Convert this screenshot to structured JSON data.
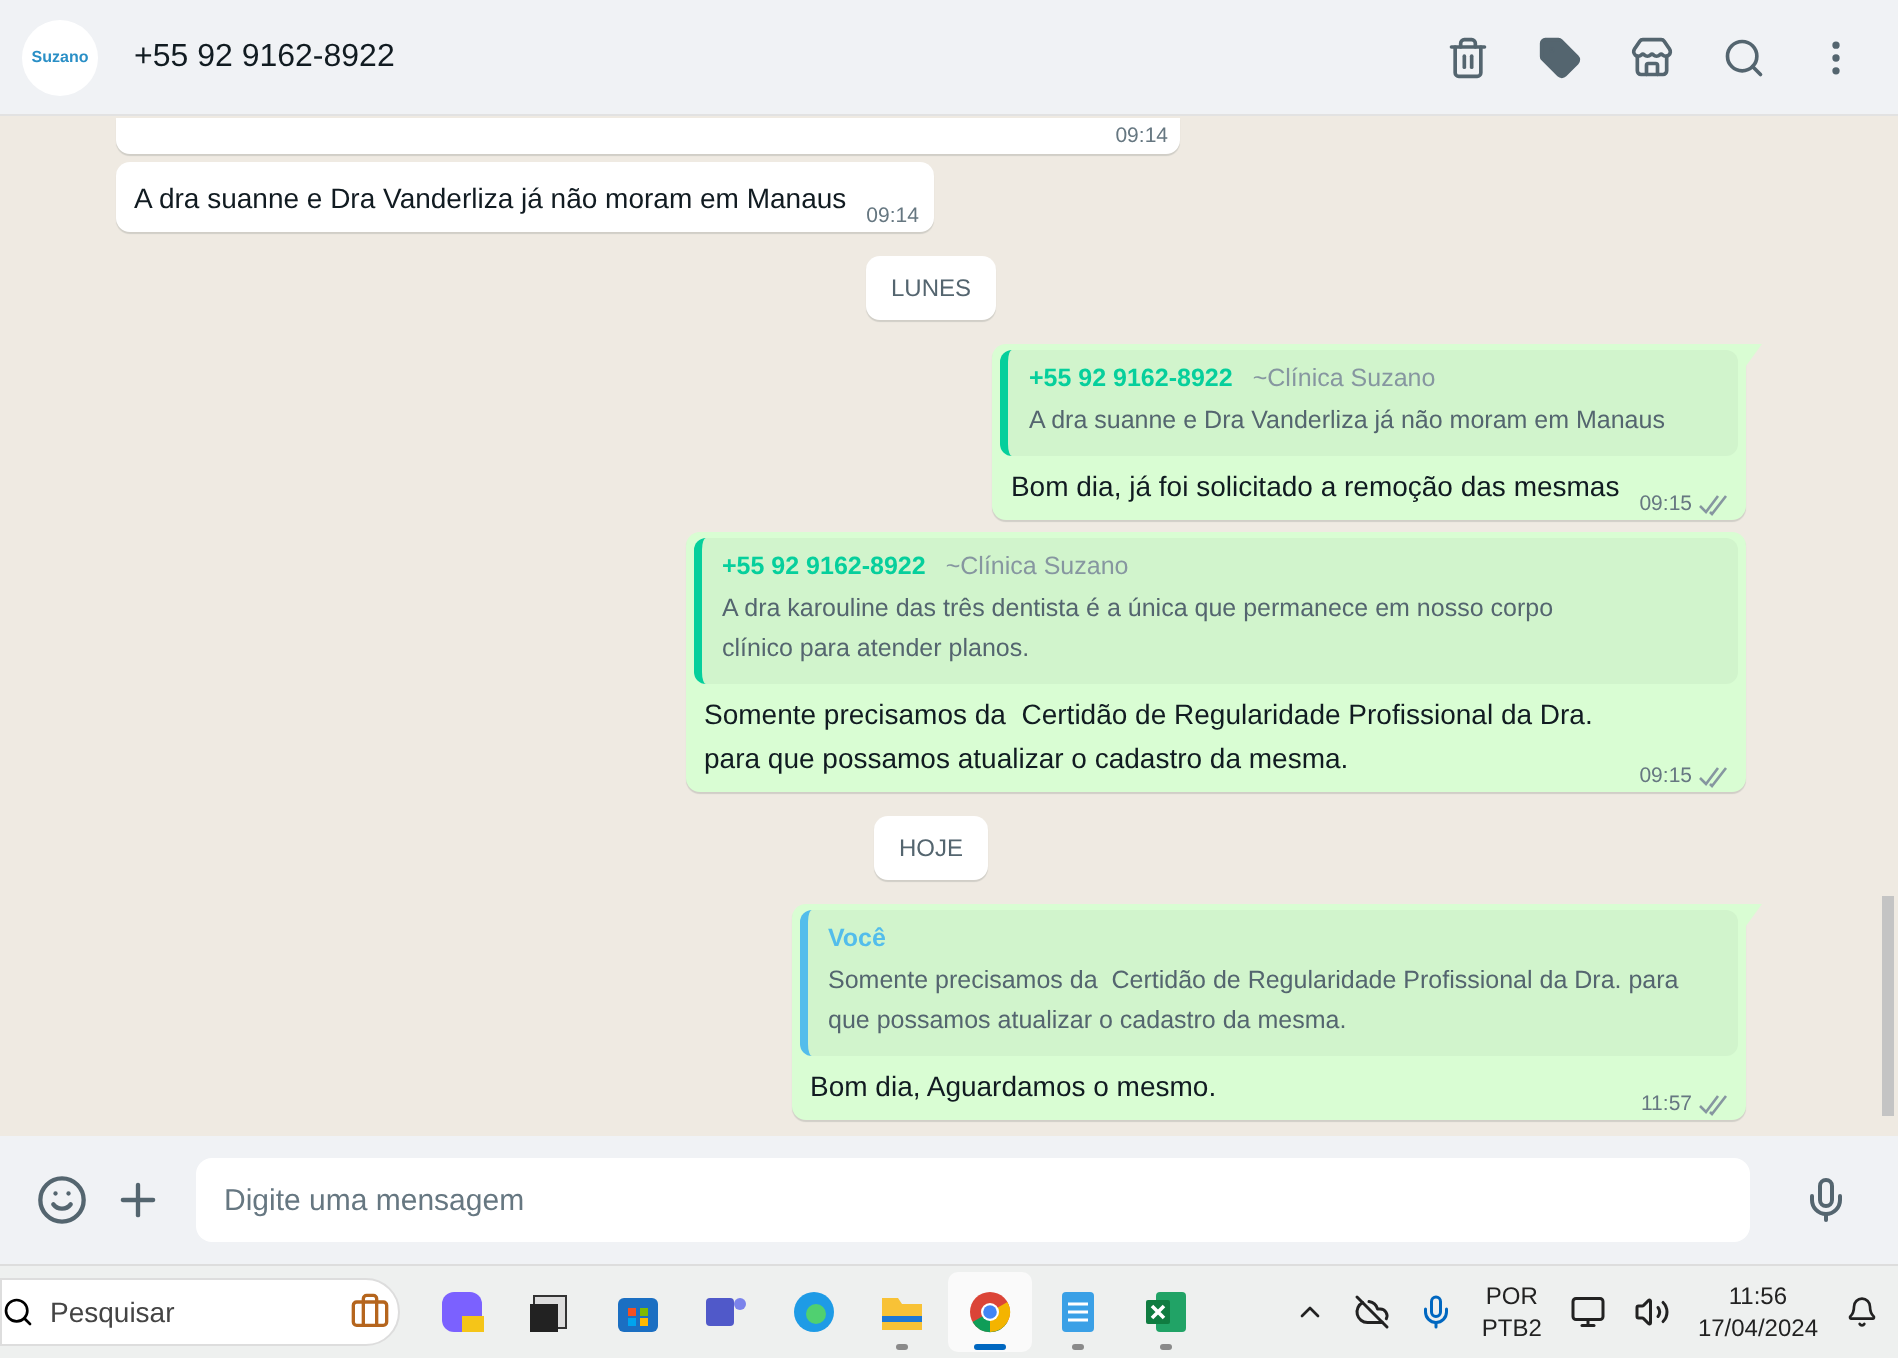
{
  "header": {
    "avatar_text": "Suzano",
    "title": "+55 92 9162-8922"
  },
  "messages": [
    {
      "kind": "incoming",
      "time": "09:14",
      "partial": true
    },
    {
      "kind": "incoming",
      "text": "A dra suanne e Dra Vanderliza já não moram em Manaus",
      "time": "09:14"
    },
    {
      "kind": "date",
      "text": "LUNES"
    },
    {
      "kind": "outgoing",
      "quote": {
        "author": "+55 92 9162-8922",
        "group": "~Clínica Suzano",
        "text": "A dra suanne e Dra Vanderliza já não moram em Manaus",
        "color": "#06cf9c"
      },
      "text": "Bom dia, já foi solicitado a remoção das mesmas",
      "time": "09:15",
      "read": false,
      "tail": true
    },
    {
      "kind": "outgoing",
      "quote": {
        "author": "+55 92 9162-8922",
        "group": "~Clínica Suzano",
        "text": "A dra karouline das três dentista é a única que permanece em nosso corpo clínico para atender planos.",
        "color": "#06cf9c"
      },
      "text": "Somente precisamos da  Certidão de Regularidade Profissional da Dra. para que possamos atualizar o cadastro da mesma.",
      "time": "09:15",
      "read": false,
      "tail": false
    },
    {
      "kind": "date",
      "text": "HOJE"
    },
    {
      "kind": "outgoing",
      "quote": {
        "author": "Você",
        "text": "Somente precisamos da  Certidão de Regularidade Profissional da Dra. para que possamos atualizar o cadastro da mesma.",
        "color": "#53bdeb"
      },
      "text": "Bom dia, Aguardamos o mesmo.",
      "time": "11:57",
      "read": false,
      "tail": true
    }
  ],
  "composer": {
    "placeholder": "Digite uma mensagem"
  },
  "taskbar": {
    "search_placeholder": "Pesquisar",
    "apps": [
      {
        "kind": "copilot",
        "running": false,
        "selected": false
      },
      {
        "kind": "windows",
        "running": false,
        "selected": false
      },
      {
        "kind": "store",
        "running": false,
        "selected": false
      },
      {
        "kind": "teams",
        "running": false,
        "selected": false
      },
      {
        "kind": "edge",
        "running": false,
        "selected": false
      },
      {
        "kind": "files",
        "running": true,
        "selected": false
      },
      {
        "kind": "chrome",
        "running": true,
        "selected": true
      },
      {
        "kind": "notepad",
        "running": true,
        "selected": false
      },
      {
        "kind": "excel",
        "running": true,
        "selected": false
      }
    ],
    "language": "POR",
    "layout": "PTB2",
    "time": "11:56",
    "date": "17/04/2024"
  }
}
